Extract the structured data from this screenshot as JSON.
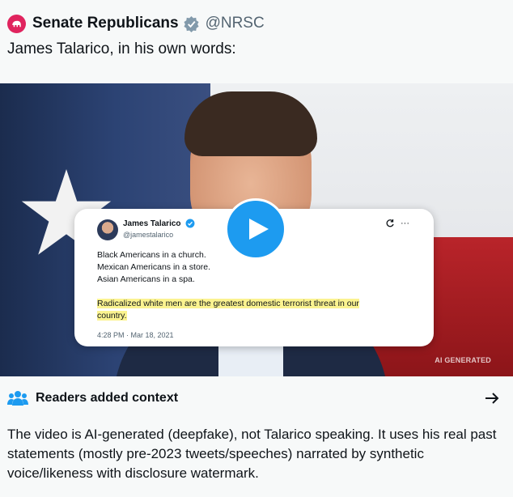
{
  "post": {
    "display_name": "Senate Republicans",
    "handle": "@NRSC",
    "text": "James Talarico, in his own words:"
  },
  "media": {
    "watermark": "AI GENERATED",
    "embedded_tweet": {
      "name": "James Talarico",
      "handle": "@jamestalarico",
      "lines": [
        "Black Americans in a church.",
        "Mexican Americans in a store.",
        "Asian Americans in a spa."
      ],
      "highlight_line1": "Radicalized white men are the greatest domestic terrorist threat in our",
      "highlight_line2": "country.",
      "timestamp": "4:28 PM · Mar 18, 2021",
      "more_label": "···"
    },
    "icons": {
      "play": "play-icon",
      "star": "star-icon"
    },
    "colors": {
      "play_blue": "#1d9bf0",
      "highlight": "#fbf390"
    }
  },
  "community_note": {
    "title": "Readers added context",
    "body": "The video is AI-generated (deepfake), not Talarico speaking. It uses his real past statements (mostly pre-2023 tweets/speeches) narrated by synthetic voice/likeness with disclosure watermark."
  }
}
